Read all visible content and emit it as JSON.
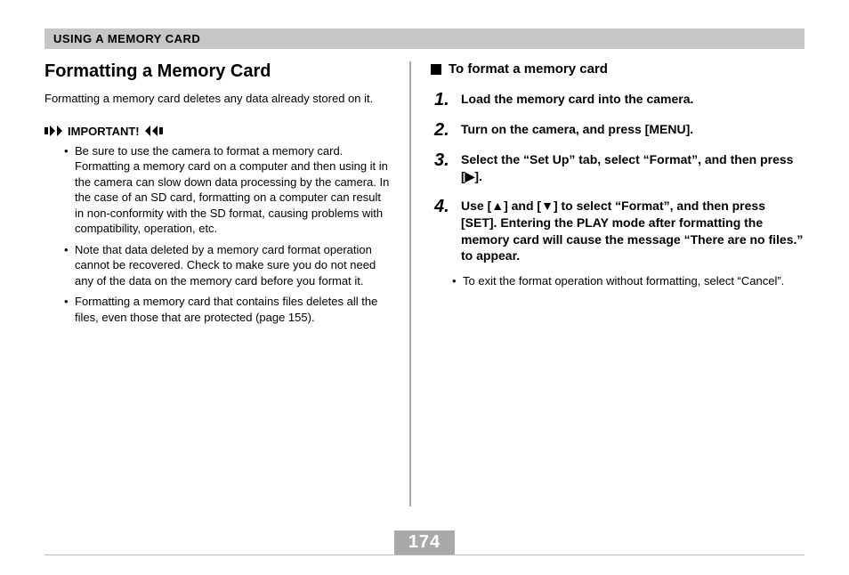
{
  "header": {
    "chapter": "USING A MEMORY CARD"
  },
  "left": {
    "title": "Formatting a Memory Card",
    "intro": "Formatting a memory card deletes any data already stored on it.",
    "important_label": "IMPORTANT!",
    "bullets": [
      "Be sure to use the camera to format a memory card. Formatting a memory card on a computer and then using it in the camera can slow down data processing by the camera. In the case of an SD card, formatting on a computer can result in non-conformity with the SD format, causing problems with compatibility, operation, etc.",
      "Note that data deleted by a memory card format operation cannot be recovered. Check to make sure you do not need any of the data on the memory card before you format it.",
      "Formatting a memory card that contains files deletes all the files, even those that are protected (page 155)."
    ]
  },
  "right": {
    "subheading": "To format a memory card",
    "steps": [
      "Load the memory card into the camera.",
      "Turn on the camera, and press [MENU].",
      "Select the “Set Up” tab, select “Format”, and then press [▶].",
      "Use [▲] and [▼] to select “Format”, and then press [SET]. Entering the PLAY mode after formatting the memory card will cause the message “There are no files.” to appear."
    ],
    "sub_bullets": [
      "To exit the format operation without formatting, select “Cancel”."
    ]
  },
  "page_number": "174"
}
